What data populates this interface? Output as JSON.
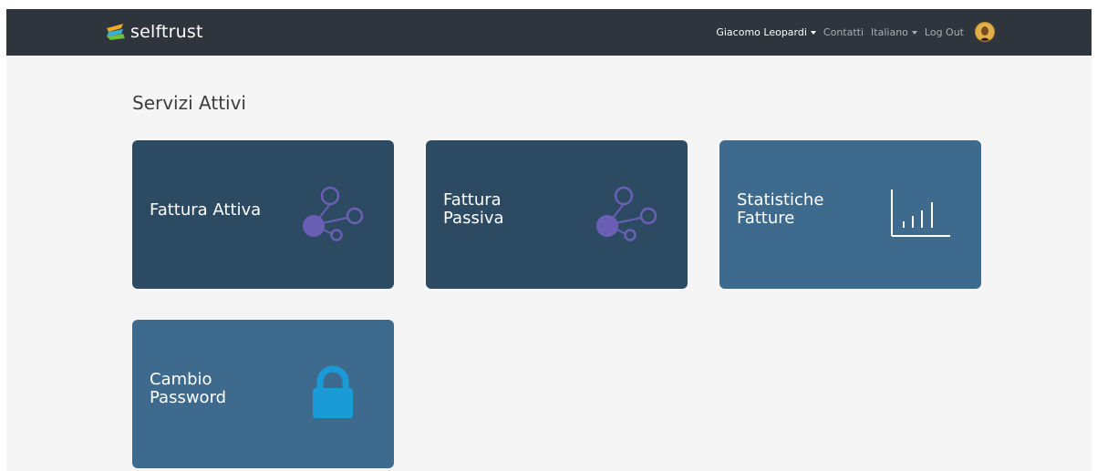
{
  "navbar": {
    "brand": "selftrust",
    "user_menu": "Giacomo Leopardi",
    "contacts": "Contatti",
    "language": "Italiano",
    "logout": "Log Out"
  },
  "main": {
    "title": "Servizi Attivi",
    "tiles": [
      {
        "line1": "Fattura Attiva",
        "line2": "",
        "icon": "share-nodes-icon"
      },
      {
        "line1": "Fattura",
        "line2": "Passiva",
        "icon": "share-nodes-icon"
      },
      {
        "line1": "Statistiche",
        "line2": "Fatture",
        "icon": "bar-chart-icon"
      },
      {
        "line1": "Cambio",
        "line2": "Password",
        "icon": "lock-icon"
      }
    ]
  },
  "colors": {
    "navbar": "#2e353d",
    "tile_dark": "#2d4a63",
    "tile_light": "#3e6a8e",
    "node_icon": "#6a5fb5",
    "lock_icon": "#1a9ad6"
  }
}
